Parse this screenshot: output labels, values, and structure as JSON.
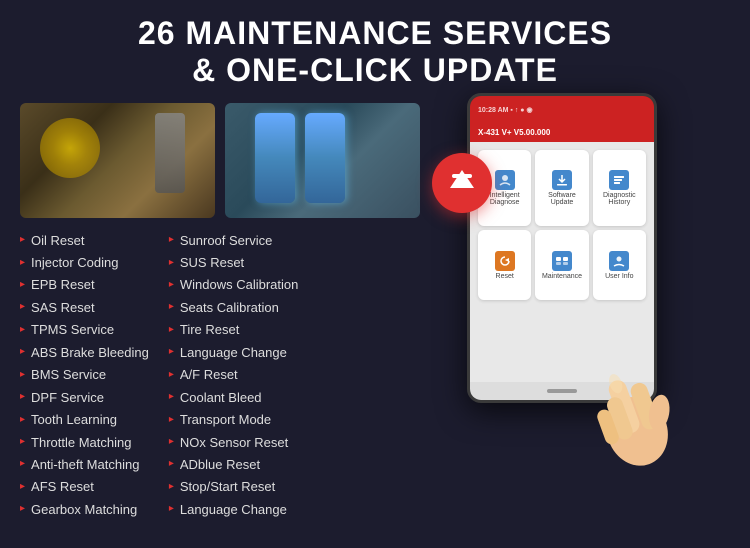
{
  "title": {
    "line1": "26 MAINTENANCE SERVICES",
    "line2": "& ONE-CLICK UPDATE"
  },
  "left_list": [
    "Oil Reset",
    "Injector Coding",
    "EPB Reset",
    "SAS Reset",
    "TPMS Service",
    "ABS Brake Bleeding",
    "BMS Service",
    "DPF Service",
    "Tooth Learning",
    "Throttle Matching",
    "Anti-theft Matching",
    "AFS Reset",
    "Gearbox Matching"
  ],
  "right_list": [
    "Sunroof Service",
    "SUS Reset",
    "Windows Calibration",
    "Seats Calibration",
    "Tire Reset",
    "Language Change",
    "A/F Reset",
    "Coolant Bleed",
    "Transport Mode",
    "NOx Sensor Reset",
    "ADblue Reset",
    "Stop/Start Reset",
    "Language Change"
  ],
  "tablet": {
    "header_title": "X-431 V+ V5.00.000",
    "icons": [
      {
        "label": "Intelligent Diagnose",
        "color": "blue"
      },
      {
        "label": "Software Update",
        "color": "orange"
      },
      {
        "label": "Diagnostic History",
        "color": "green"
      },
      {
        "label": "Reset",
        "color": "purple"
      },
      {
        "label": "Maintenance",
        "color": "red"
      },
      {
        "label": "User Info",
        "color": "teal"
      }
    ]
  },
  "upload_button": {
    "aria": "upload/update button"
  },
  "bullet": "▸",
  "colors": {
    "bg": "#1c1c2e",
    "bullet": "#e03030",
    "title_text": "#ffffff",
    "list_text": "#dddddd",
    "upload_btn": "#e03030"
  }
}
